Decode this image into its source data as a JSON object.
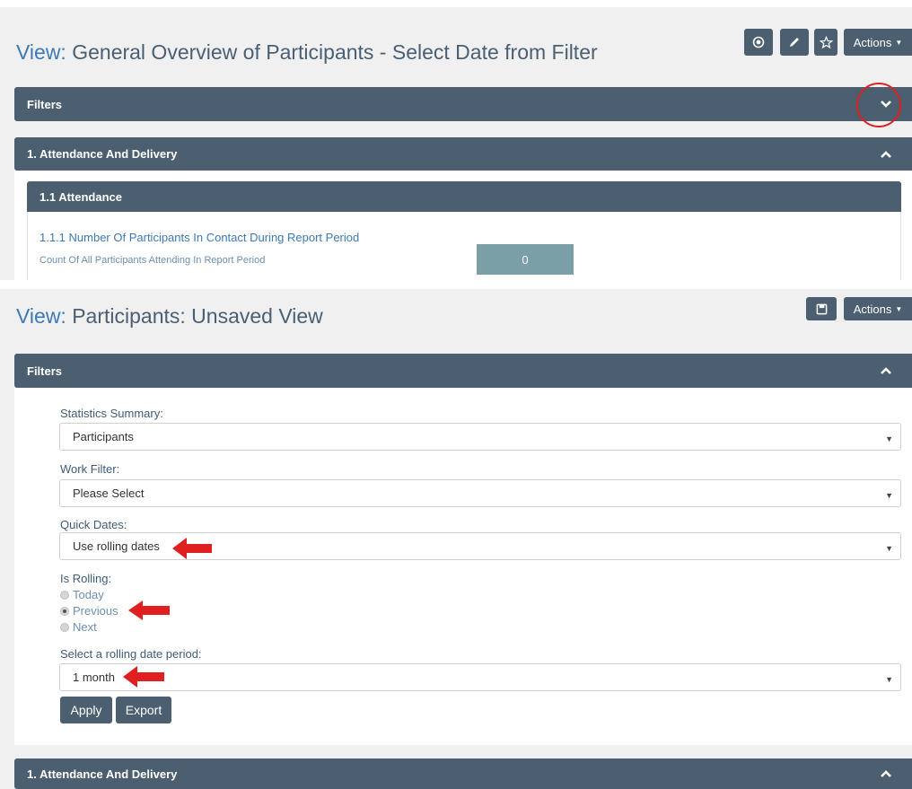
{
  "top": {
    "title_prefix": "View:",
    "title_text": "General Overview of Participants - Select Date from Filter",
    "actions_label": "Actions",
    "filters_label": "Filters",
    "section_label": "1. Attendance And Delivery",
    "subsection_label": "1.1 Attendance",
    "metric_title": "1.1.1 Number Of Participants In Contact During Report Period",
    "metric_desc": "Count Of All Participants Attending In Report Period",
    "metric_value": "0"
  },
  "bottom": {
    "title_prefix": "View:",
    "title_text": "Participants: Unsaved View",
    "actions_label": "Actions",
    "filters_label": "Filters",
    "stats_label": "Statistics Summary:",
    "stats_value": "Participants",
    "work_label": "Work Filter:",
    "work_value": "Please Select",
    "quick_label": "Quick Dates:",
    "quick_value": "Use rolling dates",
    "rolling_label": "Is Rolling:",
    "radio_today": "Today",
    "radio_previous": "Previous",
    "radio_next": "Next",
    "period_label": "Select a rolling date period:",
    "period_value": "1 month",
    "apply_label": "Apply",
    "export_label": "Export",
    "section_label": "1. Attendance And Delivery"
  },
  "icons": {
    "record": "record-icon",
    "edit": "pencil-icon",
    "favorite": "star-icon",
    "save": "save-icon",
    "expand": "chevron-down-icon",
    "collapse": "chevron-up-icon"
  },
  "colors": {
    "header_bar": "#4b5f70",
    "title": "#4a5f73",
    "link": "#3d7ab5",
    "annotation": "#e02020"
  }
}
